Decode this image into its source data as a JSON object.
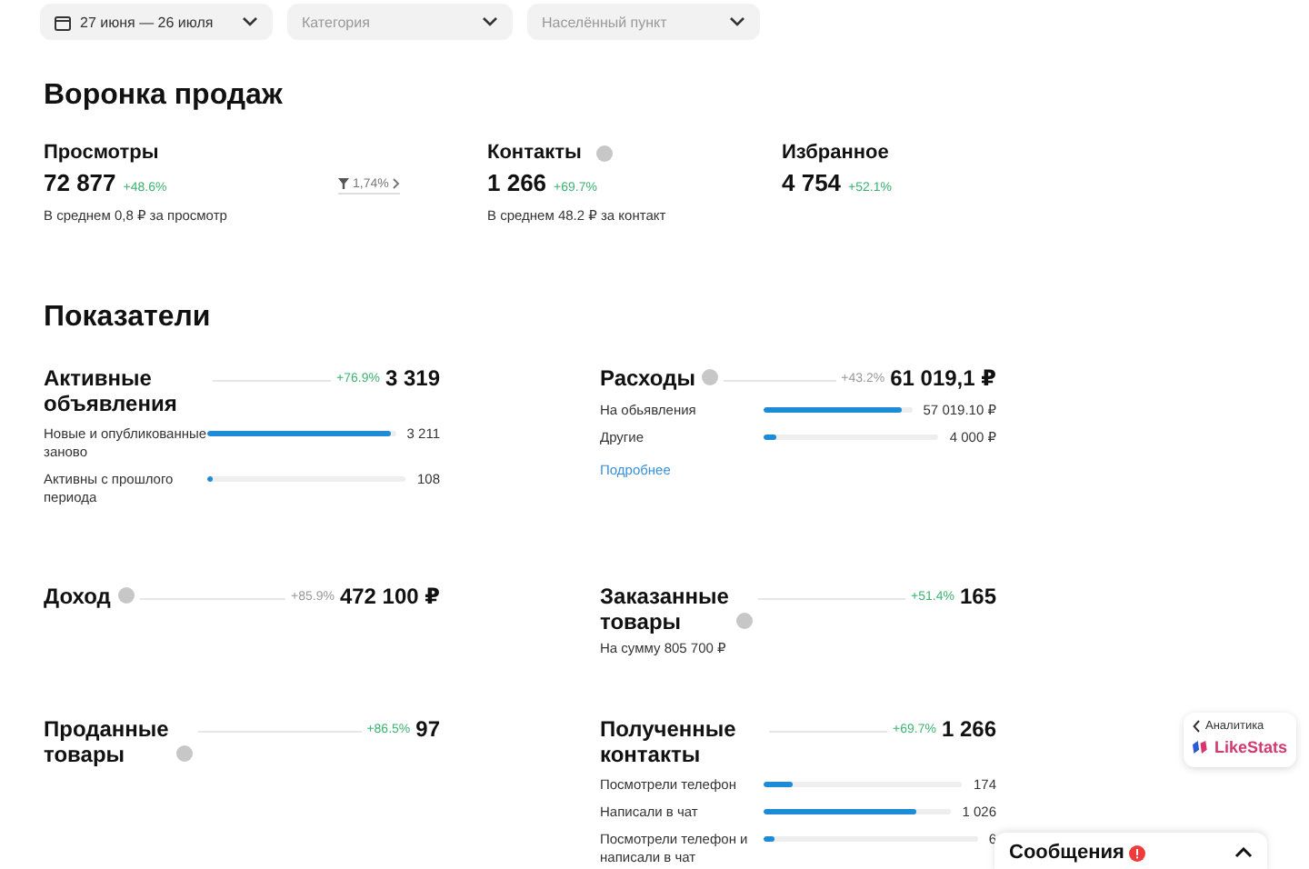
{
  "filters": [
    {
      "kind": "date",
      "text": "27 июня — 26 июля",
      "placeholder": false
    },
    {
      "kind": "select",
      "text": "Категория",
      "placeholder": true
    },
    {
      "kind": "select",
      "text": "Населённый пункт",
      "placeholder": true
    }
  ],
  "funnel": {
    "title": "Воронка продаж",
    "conversion": "1,74%",
    "stats": [
      {
        "label": "Просмотры",
        "help": false,
        "value": "72 877",
        "change": "+48.6%",
        "note": "В среднем 0,8 ₽ за просмотр"
      },
      {
        "label": "Контакты",
        "help": true,
        "value": "1 266",
        "change": "+69.7%",
        "note": "В среднем 48.2 ₽ за контакт"
      },
      {
        "label": "Избранное",
        "help": false,
        "value": "4 754",
        "change": "+52.1%"
      }
    ]
  },
  "indicators": {
    "title": "Показатели",
    "metrics": [
      {
        "title": "Активные объявления",
        "help": false,
        "change": "+76.9%",
        "positive": true,
        "value": "3 319",
        "rows": [
          {
            "label": "Новые и опубликованные заново",
            "level": 0.97,
            "value": "3 211"
          },
          {
            "label": "Активны с прошлого периода",
            "level": 0.03,
            "value": "108"
          }
        ]
      },
      {
        "title": "Расходы",
        "help": true,
        "change": "+43.2%",
        "positive": false,
        "value": "61 019,1 ₽",
        "rows": [
          {
            "label": "На обьявления",
            "level": 0.93,
            "value": "57 019.10 ₽"
          },
          {
            "label": "Другие",
            "level": 0.07,
            "value": "4 000 ₽"
          }
        ],
        "link": "Подробнее"
      },
      {
        "title": "Доход",
        "help": true,
        "change": "+85.9%",
        "positive": false,
        "value": "472 100 ₽"
      },
      {
        "title": "Заказанные товары",
        "help": true,
        "change": "+51.4%",
        "positive": true,
        "value": "165",
        "note": "На сумму 805 700 ₽"
      },
      {
        "title": "Проданные товары",
        "help": true,
        "change": "+86.5%",
        "positive": true,
        "value": "97"
      },
      {
        "title": "Полученные контакты",
        "help": false,
        "change": "+69.7%",
        "positive": true,
        "value": "1 266",
        "rows": [
          {
            "label": "Посмотрели телефон",
            "level": 0.15,
            "value": "174"
          },
          {
            "label": "Написали в чат",
            "level": 0.81,
            "value": "1 026"
          },
          {
            "label": "Посмотрели телефон и написали в чат",
            "level": 0.05,
            "value": "6"
          }
        ]
      }
    ]
  },
  "analytics_widget": {
    "back": "Аналитика",
    "brand": "LikeStats"
  },
  "messages_bar": {
    "label": "Сообщения",
    "unread": true
  }
}
